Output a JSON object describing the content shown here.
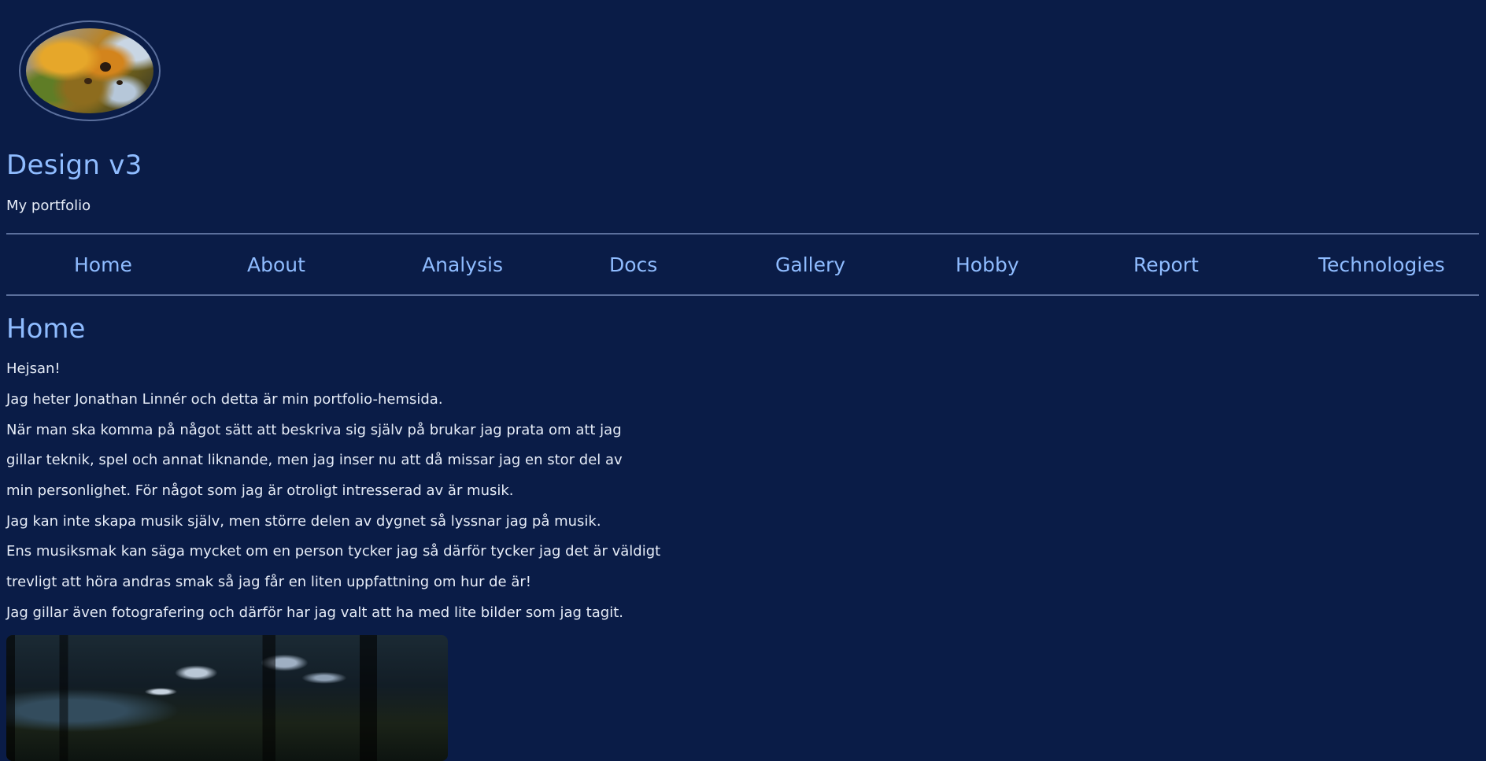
{
  "header": {
    "logo_name": "autumn-leaves-logo",
    "title": "Design v3",
    "tagline": "My portfolio"
  },
  "nav": {
    "items": [
      {
        "label": "Home"
      },
      {
        "label": "About"
      },
      {
        "label": "Analysis"
      },
      {
        "label": "Docs"
      },
      {
        "label": "Gallery"
      },
      {
        "label": "Hobby"
      },
      {
        "label": "Report"
      },
      {
        "label": "Technologies"
      }
    ]
  },
  "main": {
    "heading": "Home",
    "paragraphs": [
      "Hejsan!",
      "Jag heter Jonathan Linnér och detta är min portfolio-hemsida.",
      "När man ska komma på något sätt att beskriva sig själv på brukar jag prata om att jag",
      "gillar teknik, spel och annat liknande, men jag inser nu att då missar jag en stor del av",
      "min personlighet. För något som jag är otroligt intresserad av är musik.",
      "Jag kan inte skapa musik själv, men större delen av dygnet så lyssnar jag på musik.",
      "Ens musiksmak kan säga mycket om en person tycker jag så därför tycker jag det är väldigt",
      "trevligt att höra andras smak så jag får en liten uppfattning om hur de är!",
      "Jag gillar även fotografering och därför har jag valt att ha med lite bilder som jag tagit."
    ]
  },
  "colors": {
    "background": "#0a1c47",
    "accent": "#8fbcff",
    "text": "#e6ecf7",
    "divider": "#5b6f9c"
  }
}
